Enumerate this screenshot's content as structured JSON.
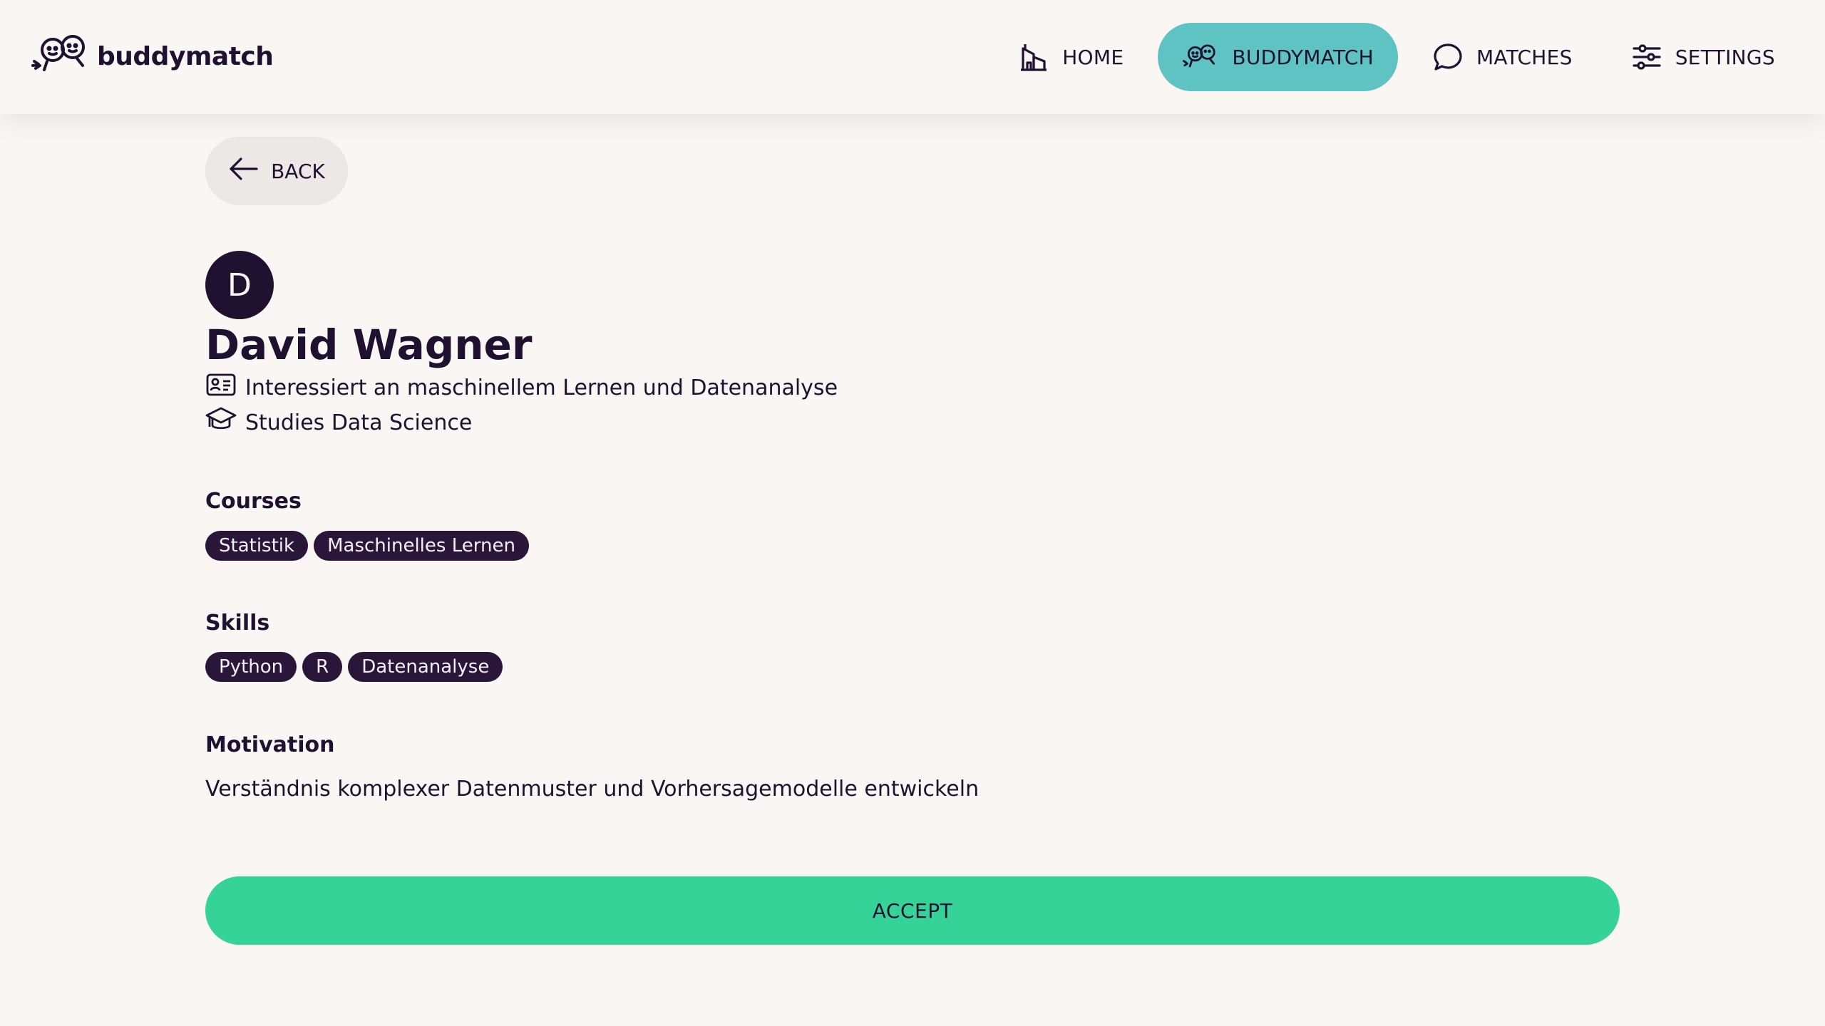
{
  "app": {
    "name": "buddymatch"
  },
  "nav": [
    {
      "label": "HOME",
      "icon": "home-icon",
      "active": false
    },
    {
      "label": "BUDDYMATCH",
      "icon": "buddies-icon",
      "active": true
    },
    {
      "label": "MATCHES",
      "icon": "chat-bubble-icon",
      "active": false
    },
    {
      "label": "SETTINGS",
      "icon": "sliders-icon",
      "active": false
    }
  ],
  "back": {
    "label": "BACK",
    "icon": "arrow-left-icon"
  },
  "profile": {
    "initial": "D",
    "name": "David Wagner",
    "bio": "Interessiert an maschinellem Lernen und Datenanalyse",
    "bio_icon": "id-card-icon",
    "study": "Studies Data Science",
    "study_icon": "graduation-cap-icon"
  },
  "courses": {
    "title": "Courses",
    "items": [
      "Statistik",
      "Maschinelles Lernen"
    ]
  },
  "skills": {
    "title": "Skills",
    "items": [
      "Python",
      "R",
      "Datenanalyse"
    ]
  },
  "motivation": {
    "title": "Motivation",
    "text": "Verständnis komplexer Datenmuster und Vorhersagemodelle entwickeln"
  },
  "accept": {
    "label": "ACCEPT"
  },
  "colors": {
    "background": "#f9f6f4",
    "primary_text": "#1e1230",
    "nav_active": "#5fc3c3",
    "accept": "#36d399",
    "chip": "#2a1638",
    "back_button": "#ece8e6"
  }
}
